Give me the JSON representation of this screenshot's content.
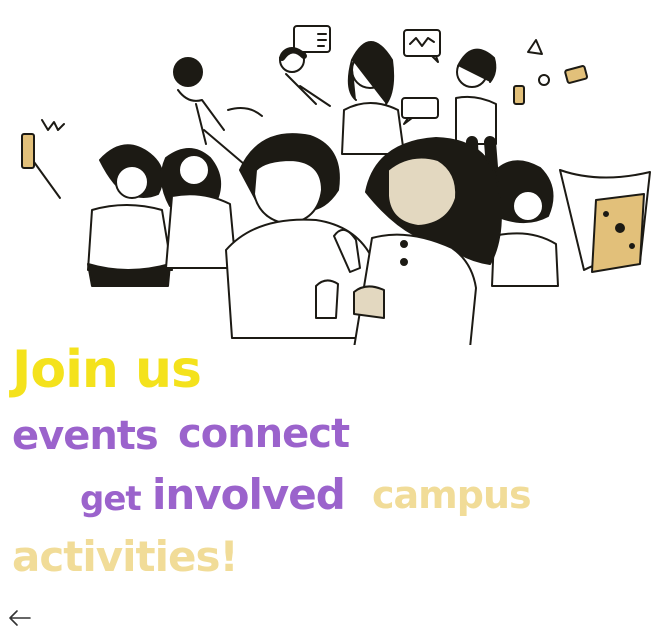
{
  "headline": {
    "join": "Join us",
    "events": "events",
    "connect": "connect",
    "get": "get",
    "involved": "involved",
    "campus": "campus",
    "activities": "activities!"
  },
  "colors": {
    "yellow": "#f4e21c",
    "purple": "#9b63cc",
    "tan": "#f1dc98",
    "ink": "#1c1a14",
    "skin_dark": "#e3d8c0",
    "accent_gold": "#e2c07a"
  },
  "icons": {
    "back": "left-arrow-icon",
    "illustration": "people-group-illustration"
  }
}
